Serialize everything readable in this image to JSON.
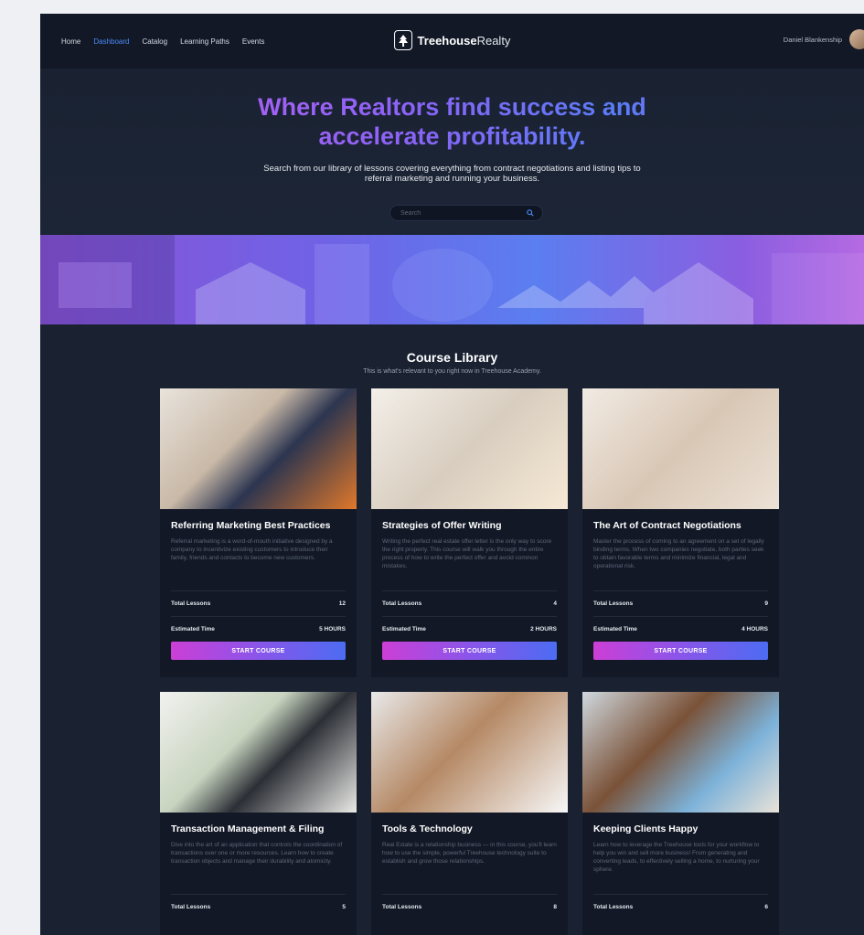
{
  "nav": {
    "links": [
      "Home",
      "Dashboard",
      "Catalog",
      "Learning Paths",
      "Events"
    ],
    "active_index": 1,
    "logo_bold": "Treehouse",
    "logo_light": "Realty",
    "user_name": "Daniel Blankenship"
  },
  "hero": {
    "title_line1": "Where Realtors find success and",
    "title_line2": "accelerate profitability.",
    "subtitle": "Search from our library of lessons covering everything from contract negotiations and listing tips to referral marketing and running your business.",
    "search_placeholder": "Search"
  },
  "library": {
    "title": "Course Library",
    "subtitle": "This is what's relevant to you right now in Treehouse Academy.",
    "lessons_label": "Total Lessons",
    "time_label": "Estimated Time",
    "button_label": "START COURSE"
  },
  "courses": [
    {
      "title": "Referring Marketing Best Practices",
      "desc": "Referral marketing is a word-of-mouth initiative designed by a company to incentivize existing customers to introduce their family, friends and contacts to become new customers.",
      "lessons": "12",
      "time": "5 HOURS"
    },
    {
      "title": "Strategies of Offer Writing",
      "desc": "Writing the perfect real estate offer letter is the only way to score the right property. This course will walk you through the entire process of how to write the perfect offer and avoid common mistakes.",
      "lessons": "4",
      "time": "2 HOURS"
    },
    {
      "title": "The Art of Contract Negotiations",
      "desc": "Master the process of coming to an agreement on a set of legally binding terms. When two companies negotiate, both parties seek to obtain favorable terms and minimize financial, legal and operational risk.",
      "lessons": "9",
      "time": "4 HOURS"
    },
    {
      "title": "Transaction Management & Filing",
      "desc": "Dive into the art of an application that controls the coordination of transactions over one or more resources. Learn how to create transaction objects and manage their durability and atomicity.",
      "lessons": "5",
      "time": ""
    },
    {
      "title": "Tools & Technology",
      "desc": "Real Estate is a relationship business — in this course, you'll learn how to use the simple, powerful Treehouse technology suite to establish and grow those relationships.",
      "lessons": "8",
      "time": ""
    },
    {
      "title": "Keeping Clients Happy",
      "desc": "Learn how to leverage the Treehouse tools for your workflow to help you win and sell more business! From generating and converting leads, to effectively selling a home, to nurturing your sphere.",
      "lessons": "6",
      "time": ""
    }
  ],
  "colors": {
    "accent": "#4a8cf7",
    "bg": "#1a2232",
    "card": "#121826"
  },
  "icons": {
    "search": "search-icon",
    "logo": "tree-icon"
  }
}
